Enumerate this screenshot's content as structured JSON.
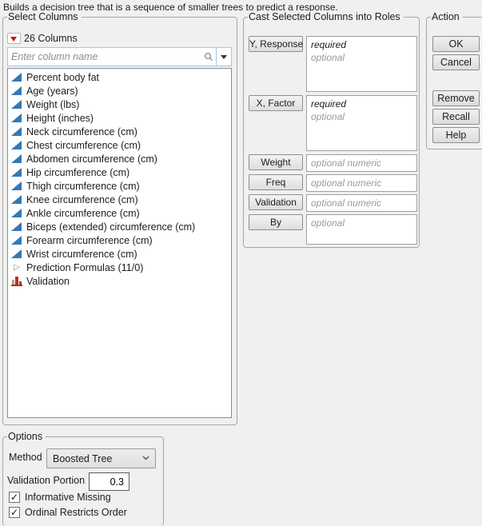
{
  "description": "Builds a decision tree that is a sequence of smaller trees to predict a response.",
  "select_columns": {
    "title": "Select Columns",
    "columns_menu_label": "26 Columns",
    "search_placeholder": "Enter column name",
    "items": [
      {
        "label": "Percent body fat",
        "icon": "continuous"
      },
      {
        "label": "Age (years)",
        "icon": "continuous"
      },
      {
        "label": "Weight (lbs)",
        "icon": "continuous"
      },
      {
        "label": "Height (inches)",
        "icon": "continuous"
      },
      {
        "label": "Neck circumference (cm)",
        "icon": "continuous"
      },
      {
        "label": "Chest circumference (cm)",
        "icon": "continuous"
      },
      {
        "label": "Abdomen circumference (cm)",
        "icon": "continuous"
      },
      {
        "label": "Hip circumference (cm)",
        "icon": "continuous"
      },
      {
        "label": "Thigh circumference (cm)",
        "icon": "continuous"
      },
      {
        "label": "Knee circumference (cm)",
        "icon": "continuous"
      },
      {
        "label": "Ankle circumference (cm)",
        "icon": "continuous"
      },
      {
        "label": "Biceps (extended) circumference (cm)",
        "icon": "continuous"
      },
      {
        "label": "Forearm circumference (cm)",
        "icon": "continuous"
      },
      {
        "label": "Wrist circumference (cm)",
        "icon": "continuous"
      },
      {
        "label": "Prediction Formulas (11/0)",
        "icon": "expand"
      },
      {
        "label": "Validation",
        "icon": "nominal"
      }
    ]
  },
  "cast_roles": {
    "title": "Cast Selected Columns into Roles",
    "roles": [
      {
        "label": "Y, Response",
        "line1": "required",
        "line2": "optional"
      },
      {
        "label": "X, Factor",
        "line1": "required",
        "line2": "optional"
      },
      {
        "label": "Weight",
        "placeholder": "optional numeric"
      },
      {
        "label": "Freq",
        "placeholder": "optional numeric"
      },
      {
        "label": "Validation",
        "placeholder": "optional numeric"
      },
      {
        "label": "By",
        "placeholder": "optional"
      }
    ]
  },
  "action": {
    "title": "Action",
    "buttons": [
      "OK",
      "Cancel",
      "Remove",
      "Recall",
      "Help"
    ]
  },
  "options": {
    "title": "Options",
    "method_label": "Method",
    "method_value": "Boosted Tree",
    "validation_portion_label": "Validation Portion",
    "validation_portion_value": "0.3",
    "checkboxes": [
      {
        "label": "Informative Missing",
        "checked": true
      },
      {
        "label": "Ordinal Restricts Order",
        "checked": true
      }
    ]
  },
  "colors": {
    "window_bg": "#f0f0f0",
    "continuous_icon_blue": "#3578b5",
    "nominal_icon_red": "#b03425",
    "disclosure_red": "#cc1111",
    "search_border_blue": "#a3c6e8",
    "muted_text": "#9a9a9a"
  },
  "icons": {
    "disclosure": "red-triangle-icon",
    "search": "search-icon",
    "search_dropdown": "chevron-down-icon",
    "combo": "chevron-down-icon",
    "checked": "checkmark-icon"
  }
}
